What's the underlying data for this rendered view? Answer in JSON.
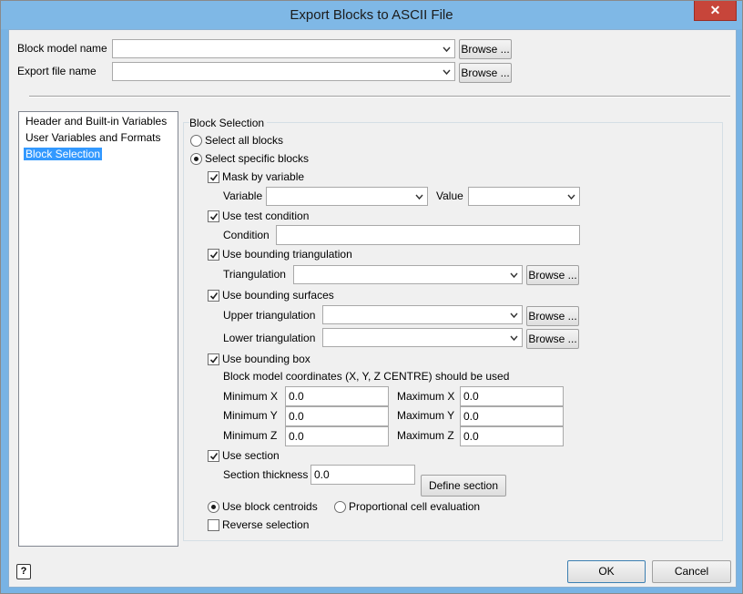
{
  "window": {
    "title": "Export Blocks to ASCII File",
    "close_glyph": "✕"
  },
  "top": {
    "block_model_label": "Block model name",
    "export_file_label": "Export file name",
    "browse_label": "Browse ..."
  },
  "nav": {
    "items": [
      {
        "label": "Header and Built-in Variables",
        "selected": false
      },
      {
        "label": "User Variables and Formats",
        "selected": false
      },
      {
        "label": "Block Selection",
        "selected": true
      }
    ]
  },
  "block_selection": {
    "group_title": "Block Selection",
    "select_all": "Select all blocks",
    "select_specific": "Select specific blocks",
    "mask_by_variable": "Mask by variable",
    "variable_label": "Variable",
    "value_label": "Value",
    "use_test_condition": "Use test condition",
    "condition_label": "Condition",
    "use_bounding_triangulation": "Use bounding triangulation",
    "triangulation_label": "Triangulation",
    "browse_label": "Browse ...",
    "use_bounding_surfaces": "Use bounding surfaces",
    "upper_triangulation_label": "Upper triangulation",
    "lower_triangulation_label": "Lower triangulation",
    "use_bounding_box": "Use bounding box",
    "bbox_note": "Block model coordinates (X, Y, Z CENTRE) should be used",
    "min_x_label": "Minimum X",
    "min_x": "0.0",
    "min_y_label": "Minimum Y",
    "min_y": "0.0",
    "min_z_label": "Minimum Z",
    "min_z": "0.0",
    "max_x_label": "Maximum X",
    "max_x": "0.0",
    "max_y_label": "Maximum Y",
    "max_y": "0.0",
    "max_z_label": "Maximum Z",
    "max_z": "0.0",
    "use_section": "Use section",
    "section_thickness_label": "Section thickness",
    "section_thickness": "0.0",
    "define_section": "Define section",
    "use_block_centroids": "Use block centroids",
    "proportional_cell": "Proportional cell evaluation",
    "reverse_selection": "Reverse selection"
  },
  "footer": {
    "ok": "OK",
    "cancel": "Cancel",
    "help_glyph": "?"
  },
  "colors": {
    "titlebar": "#7fb8e6",
    "close": "#c7453a",
    "selection": "#3399ff"
  }
}
